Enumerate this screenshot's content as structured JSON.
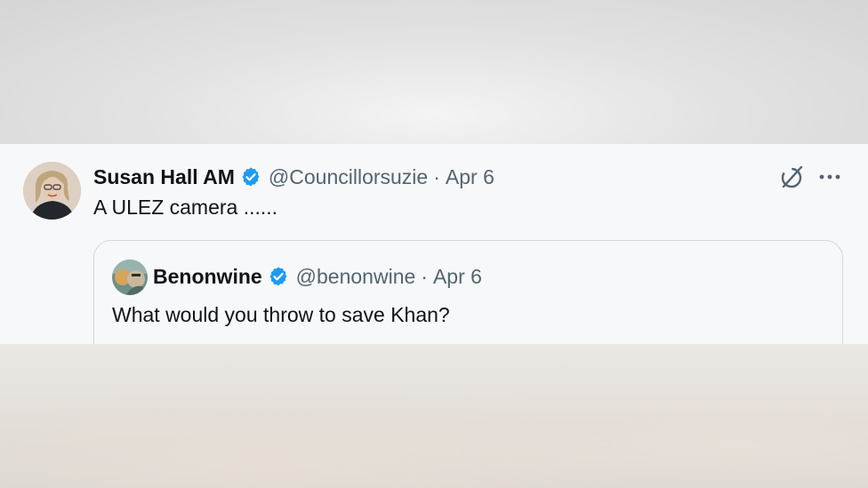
{
  "tweet": {
    "author_name": "Susan Hall AM",
    "handle": "@Councillorsuzie",
    "separator": "·",
    "date": "Apr 6",
    "text": "A ULEZ camera ......"
  },
  "quoted_tweet": {
    "author_name": "Benonwine",
    "handle": "@benonwine",
    "separator": "·",
    "date": "Apr 6",
    "text": "What would you throw to save Khan?"
  },
  "icons": {
    "verified": "verified-badge-icon",
    "grok": "grok-icon",
    "more": "more-options-icon"
  },
  "colors": {
    "verified_blue": "#1d9bf0",
    "primary_text": "#0f1419",
    "secondary_text": "#536471",
    "border": "#cfd9de",
    "background": "#f7f8f9"
  }
}
